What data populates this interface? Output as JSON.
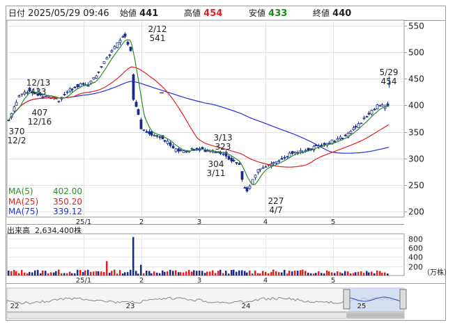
{
  "header": {
    "date_label": "日付",
    "datetime": "2025/05/29 09:46",
    "open_label": "始値",
    "open": "441",
    "high_label": "高値",
    "high": "454",
    "low_label": "安値",
    "low": "433",
    "close_label": "終値",
    "close": "440"
  },
  "legend": [
    {
      "label": "MA(5)",
      "value": "402.00",
      "color": "#2e8b2e"
    },
    {
      "label": "MA(25)",
      "value": "350.20",
      "color": "#e02020"
    },
    {
      "label": "MA(75)",
      "value": "339.12",
      "color": "#2030e0"
    }
  ],
  "colors": {
    "up": "#ffffff",
    "down": "#1a2a8a",
    "ma5": "#2e8b2e",
    "ma25": "#e02020",
    "ma75": "#2030e0",
    "vol_up": "#e02020",
    "vol_down": "#1a2a8a"
  },
  "price_axis": {
    "ticks": [
      "550",
      "500",
      "450",
      "400",
      "350",
      "300",
      "250",
      "200"
    ]
  },
  "month_labels": [
    "25/1",
    "2",
    "3",
    "4",
    "5"
  ],
  "annotations": [
    {
      "lines": [
        "2/12",
        "541"
      ]
    },
    {
      "lines": [
        "12/13",
        "433"
      ]
    },
    {
      "lines": [
        "407",
        "12/16"
      ]
    },
    {
      "lines": [
        "370",
        "12/2"
      ]
    },
    {
      "lines": [
        "3/13",
        "323"
      ]
    },
    {
      "lines": [
        "304",
        "3/11"
      ]
    },
    {
      "lines": [
        "227",
        "4/7"
      ]
    },
    {
      "lines": [
        "5/29",
        "454"
      ]
    }
  ],
  "volume": {
    "title": "出来高",
    "value": "2,634,400株",
    "ticks": [
      "800",
      "600",
      "400",
      "200"
    ],
    "unit": "（万株）"
  },
  "navigator": {
    "labels": [
      "22",
      "23",
      "24",
      "25"
    ]
  },
  "chart_data": {
    "type": "candlestick",
    "price_ylim": [
      190,
      560
    ],
    "volume_ylim": [
      0,
      900
    ],
    "volume_unit": "万株",
    "ma_latest": {
      "MA(5)": 402.0,
      "MA(25)": 350.2,
      "MA(75)": 339.12
    },
    "highlights": [
      {
        "date": "2/12",
        "value": 541,
        "type": "high"
      },
      {
        "date": "12/13",
        "value": 433,
        "type": "high"
      },
      {
        "date": "12/16",
        "value": 407,
        "type": "low"
      },
      {
        "date": "12/2",
        "value": 370,
        "type": "low"
      },
      {
        "date": "3/13",
        "value": 323,
        "type": "high"
      },
      {
        "date": "3/11",
        "value": 304,
        "type": "low"
      },
      {
        "date": "4/7",
        "value": 227,
        "type": "low"
      },
      {
        "date": "5/29",
        "value": 454,
        "type": "high"
      }
    ],
    "last_session": {
      "date": "2025/05/29",
      "open": 441,
      "high": 454,
      "low": 433,
      "close": 440
    }
  }
}
